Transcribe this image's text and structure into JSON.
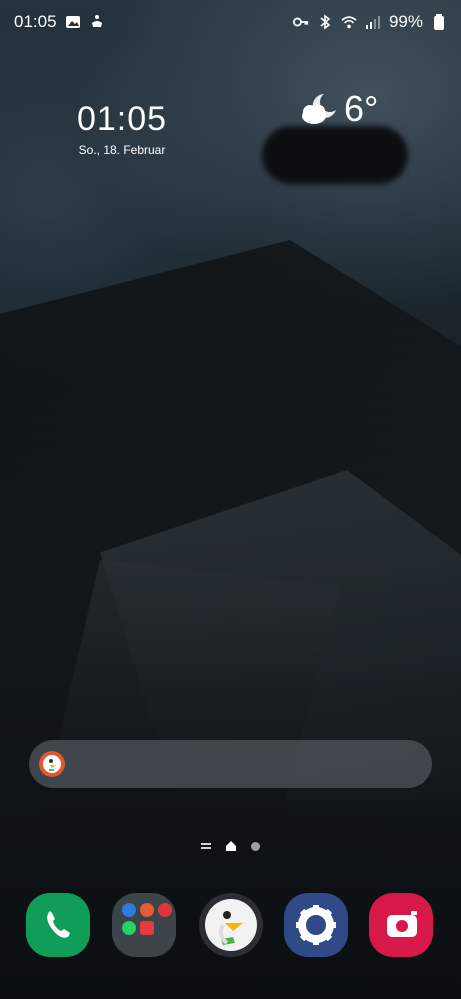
{
  "status_bar": {
    "time": "01:05",
    "battery_percent": "99%"
  },
  "clock_widget": {
    "time": "01:05",
    "date": "So., 18. Februar"
  },
  "weather_widget": {
    "temperature": "6°"
  },
  "page_indicator": {
    "pages": [
      "menu",
      "home",
      "page-2"
    ],
    "active": "home"
  },
  "dock": {
    "apps": [
      "Phone",
      "Folder",
      "DuckDuckGo",
      "Settings",
      "Camera"
    ]
  },
  "colors": {
    "phone": "#0f9d58",
    "settings": "#2f4a86",
    "camera": "#d7194a",
    "duckduckgo": "#de5833"
  }
}
